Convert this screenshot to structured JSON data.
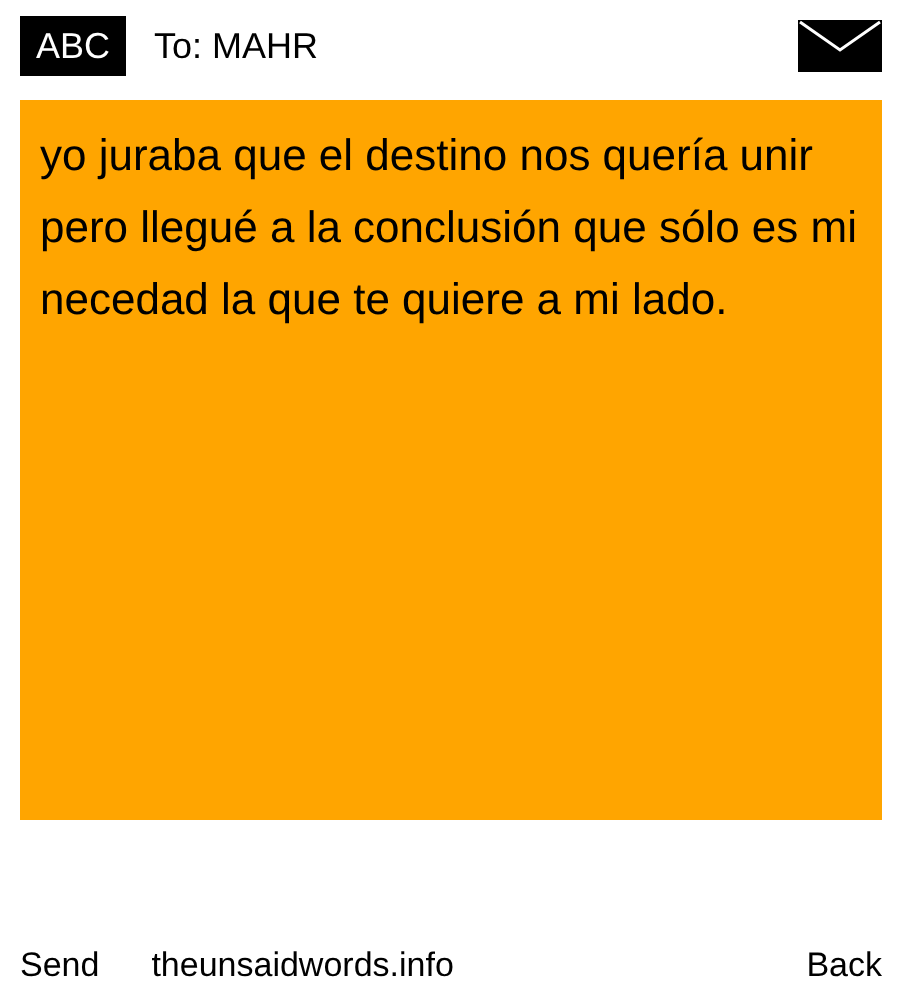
{
  "header": {
    "badge": "ABC",
    "recipient": "To: MAHR"
  },
  "message": "yo juraba que el destino nos quería unir pero llegué a la conclusión que sólo es mi necedad la que te quiere a mi lado.",
  "footer": {
    "send": "Send",
    "site": "theunsaidwords.info",
    "back": "Back"
  }
}
